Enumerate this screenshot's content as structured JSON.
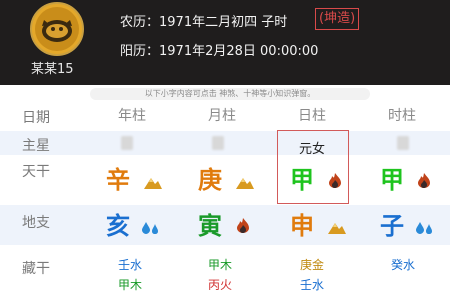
{
  "header": {
    "username": "某某15",
    "lunar": "农历：1971年二月初四 子时",
    "tag": "(坤造)",
    "solar": "阳历：1971年2月28日 00:00:00"
  },
  "notice": "以下小字内容可点击 神煞、十神等小知识弹窗。",
  "row_labels": [
    "日期",
    "主星",
    "天干",
    "地支",
    "藏干"
  ],
  "columns": [
    {
      "header": "年柱",
      "zhuxing": "",
      "gan": "辛",
      "gan_color": "#e07b0d",
      "gan_icon": "mountain-icon",
      "zhi": "亥",
      "zhi_color": "#1a6fd0",
      "zhi_icon": "water-drops-icon",
      "cang": [
        "壬水",
        "甲木"
      ],
      "cang_colors": [
        "#1a6fd0",
        "#1a9a2a"
      ]
    },
    {
      "header": "月柱",
      "zhuxing": "",
      "gan": "庚",
      "gan_color": "#e07b0d",
      "gan_icon": "mountain-icon",
      "zhi": "寅",
      "zhi_color": "#1a9a2a",
      "zhi_icon": "fire-icon",
      "cang": [
        "甲木",
        "丙火"
      ],
      "cang_colors": [
        "#1a9a2a",
        "#d03030"
      ]
    },
    {
      "header": "日柱",
      "zhuxing": "元女",
      "gan": "甲",
      "gan_color": "#1ec41e",
      "gan_icon": "fire-icon",
      "zhi": "申",
      "zhi_color": "#e07b0d",
      "zhi_icon": "mountain-icon",
      "cang": [
        "庚金",
        "壬水"
      ],
      "cang_colors": [
        "#c08a10",
        "#1a6fd0"
      ]
    },
    {
      "header": "时柱",
      "zhuxing": "",
      "gan": "甲",
      "gan_color": "#1ec41e",
      "gan_icon": "fire-icon",
      "zhi": "子",
      "zhi_color": "#1a6fd0",
      "zhi_icon": "water-drops-icon",
      "cang": [
        "癸水"
      ],
      "cang_colors": [
        "#1a6fd0"
      ]
    }
  ],
  "colors": {
    "header_bg": "#1f1d1d",
    "highlight_border": "#d25a5a",
    "row_stripe": "#eef3fb"
  }
}
